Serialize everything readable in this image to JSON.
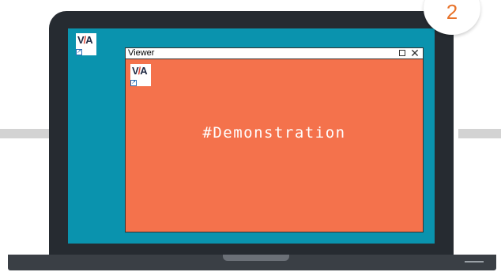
{
  "step_badge": {
    "number": "2",
    "color": "#e8732a"
  },
  "desktop": {
    "background_color": "#0a93ae",
    "icon": {
      "logo_text_v": "V",
      "logo_text_slash": "/",
      "logo_text_a": "A",
      "icon": "via-app-icon"
    }
  },
  "window": {
    "title": "Viewer",
    "maximize_icon": "square-icon",
    "close_label": "✕",
    "background_color": "#f4724c",
    "content_text": "#Demonstration",
    "icon": {
      "logo_text_v": "V",
      "logo_text_slash": "/",
      "logo_text_a": "A",
      "icon": "via-app-icon"
    }
  }
}
